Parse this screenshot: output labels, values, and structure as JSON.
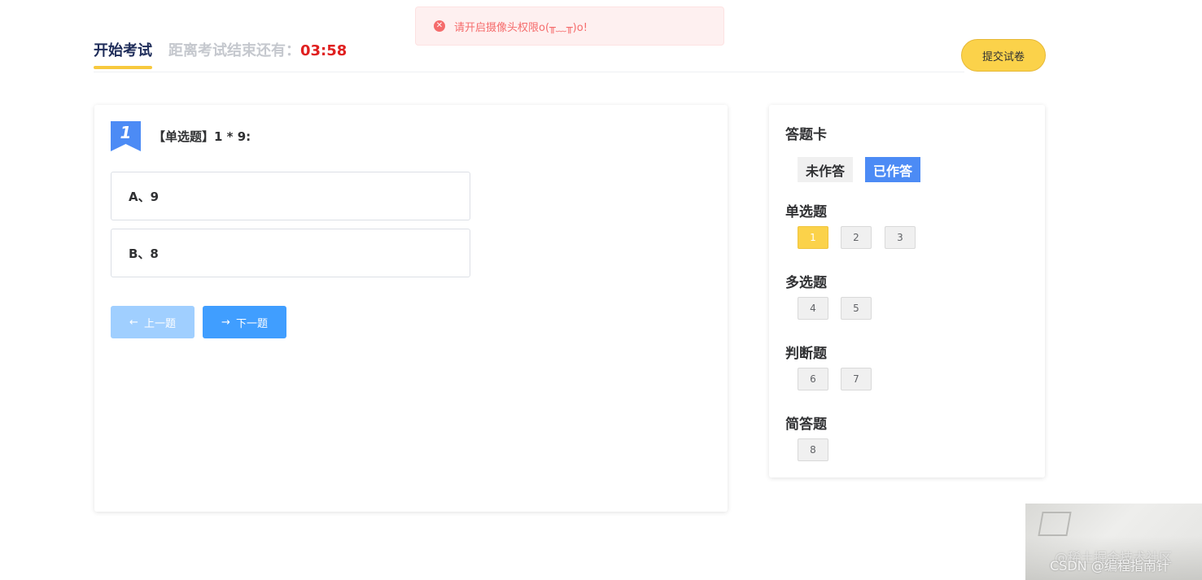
{
  "toast": {
    "message": "请开启摄像头权限o(╥﹏╥)o!",
    "icon": "error-circle-icon"
  },
  "header": {
    "tab_label": "开始考试",
    "timer_label": "距离考试结束还有：",
    "timer_value": "03:58",
    "submit_label": "提交试卷"
  },
  "question": {
    "number": "1",
    "title": "【单选题】1 * 9:",
    "options": [
      {
        "label": "A、9"
      },
      {
        "label": "B、8"
      }
    ],
    "prev_label": "上一题",
    "next_label": "下一题"
  },
  "answer_card": {
    "title": "答题卡",
    "legend_unanswered": "未作答",
    "legend_answered": "已作答",
    "sections": [
      {
        "title": "单选题",
        "questions": [
          "1",
          "2",
          "3"
        ]
      },
      {
        "title": "多选题",
        "questions": [
          "4",
          "5"
        ]
      },
      {
        "title": "判断题",
        "questions": [
          "6",
          "7"
        ]
      },
      {
        "title": "简答题",
        "questions": [
          "8"
        ]
      }
    ],
    "current_question": "1"
  },
  "watermark": {
    "line1": "@稀土掘金技术社区",
    "line2": "CSDN @编程指南针"
  },
  "colors": {
    "accent_yellow": "#fbd24a",
    "primary_blue": "#409eff",
    "timer_red": "#e02020",
    "answered_blue": "#4c8bf5"
  }
}
